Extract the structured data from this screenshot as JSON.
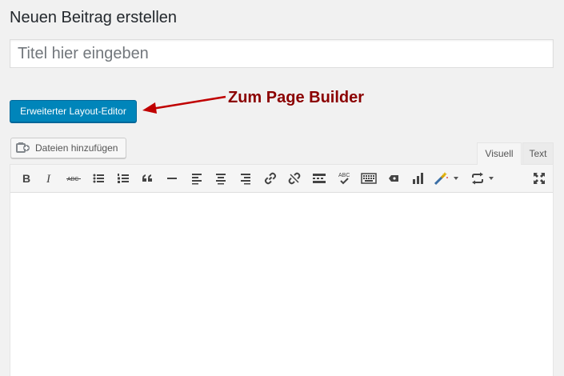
{
  "page": {
    "title": "Neuen Beitrag erstellen"
  },
  "title_field": {
    "placeholder": "Titel hier eingeben",
    "value": ""
  },
  "layout_editor": {
    "label": "Erweiterter Layout-Editor"
  },
  "annotation": {
    "text": "Zum Page Builder",
    "color": "#8b0000"
  },
  "media": {
    "label": "Dateien hinzufügen",
    "icon": "add-media-icon"
  },
  "editor_tabs": {
    "visual": "Visuell",
    "text": "Text",
    "active": "visual"
  },
  "toolbar": {
    "buttons": [
      "bold-icon",
      "italic-icon",
      "strikethrough-icon",
      "bullet-list-icon",
      "numbered-list-icon",
      "blockquote-icon",
      "horizontal-line-icon",
      "align-left-icon",
      "align-center-icon",
      "align-right-icon",
      "link-icon",
      "unlink-icon",
      "read-more-icon",
      "spellcheck-icon",
      "toolbar-toggle-icon",
      "shortcode-icon",
      "chart-icon",
      "magic-wand-icon",
      "loop-icon",
      "fullscreen-icon"
    ]
  },
  "colors": {
    "primary_button": "#0085ba",
    "background": "#f1f1f1",
    "icon": "#555555"
  }
}
